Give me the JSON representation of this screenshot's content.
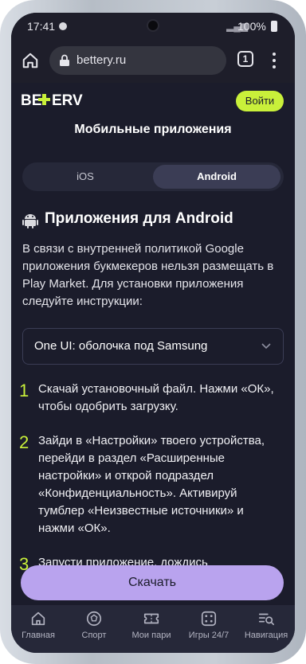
{
  "status": {
    "time": "17:41",
    "battery": "100%"
  },
  "browser": {
    "url": "bettery.ru",
    "tab_count": "1"
  },
  "site": {
    "logo_text": "BETERV",
    "login_label": "Войти",
    "page_title": "Мобильные приложения"
  },
  "platform_tabs": [
    {
      "label": "iOS",
      "active": false
    },
    {
      "label": "Android",
      "active": true
    }
  ],
  "section": {
    "title": "Приложения для Android",
    "intro": "В связи с внутренней политикой Google приложения букмекеров нельзя размещать в Play Market. Для установки приложения следуйте инструкции:"
  },
  "shell_select": {
    "value": "One UI: оболочка под Samsung"
  },
  "steps": [
    {
      "num": "1",
      "text": "Скачай установочный файл. Нажми «ОК», чтобы одобрить загрузку."
    },
    {
      "num": "2",
      "text": "Зайди в «Настройки» твоего устройства, перейди в раздел «Расширенные настройки» и открой подраздел «Конфиденциальность». Активируй тумблер «Неизвестные источники» и нажми «ОК»."
    },
    {
      "num": "3",
      "text": "Запусти приложение, дождись"
    }
  ],
  "download_label": "Скачать",
  "bottom_nav": [
    {
      "label": "Главная",
      "icon": "home-icon"
    },
    {
      "label": "Спорт",
      "icon": "ball-icon"
    },
    {
      "label": "Мои пари",
      "icon": "ticket-icon"
    },
    {
      "label": "Игры 24/7",
      "icon": "dice-icon"
    },
    {
      "label": "Навигация",
      "icon": "menu-search-icon"
    }
  ],
  "colors": {
    "background": "#1b1c2b",
    "accent_lime": "#c9f03a",
    "download_button": "#b9a3ee",
    "nav_bar": "#262839"
  }
}
